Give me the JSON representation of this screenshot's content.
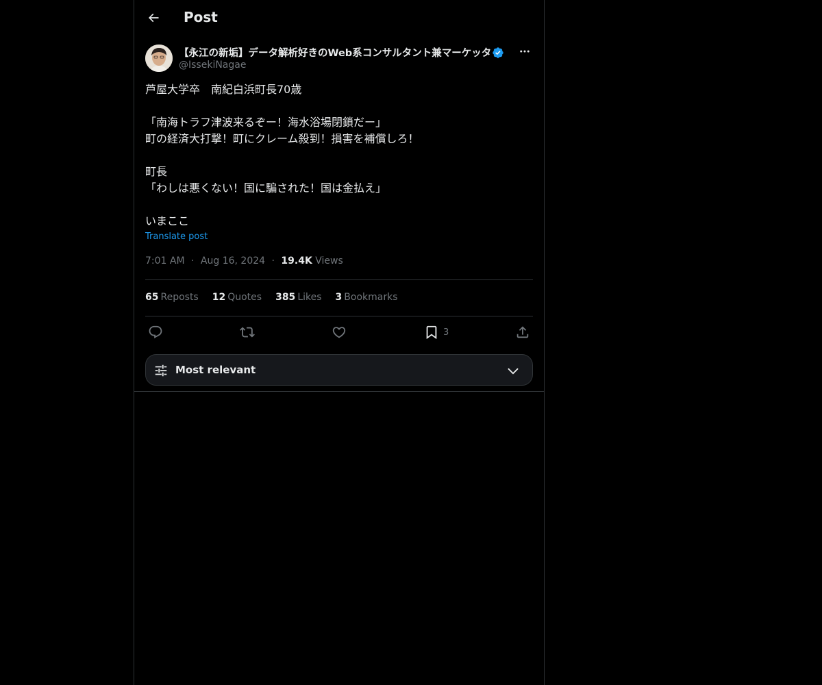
{
  "header": {
    "title": "Post",
    "back_icon": "arrow-left-icon"
  },
  "author": {
    "display_name": "【永江の新垢】データ解析好きのWeb系コンサルタント兼マーケッタ·",
    "handle": "@IssekiNagae",
    "verified_icon": "verified-badge-icon",
    "more_icon": "more-dots-icon"
  },
  "post": {
    "lines": [
      "芦屋大学卒　南紀白浜町長70歳",
      "",
      "「南海トラフ津波来るぞー！海水浴場閉鎖だー」",
      "町の経済大打撃！町にクレーム殺到！損害を補償しろ！",
      "",
      "町長",
      "「わしは悪くない！国に騙された！国は金払え」",
      "",
      "いまここ"
    ],
    "translate_label": "Translate post"
  },
  "meta": {
    "time": "7:01 AM",
    "separator": "·",
    "date": "Aug 16, 2024",
    "views_count": "19.4K",
    "views_label": "Views"
  },
  "stats": {
    "reposts": {
      "count": "65",
      "label": "Reposts"
    },
    "quotes": {
      "count": "12",
      "label": "Quotes"
    },
    "likes": {
      "count": "385",
      "label": "Likes"
    },
    "bookmarks": {
      "count": "3",
      "label": "Bookmarks"
    }
  },
  "actions": {
    "reply_icon": "reply-icon",
    "repost_icon": "repost-icon",
    "like_icon": "heart-icon",
    "bookmark_icon": "bookmark-icon",
    "bookmark_count": "3",
    "share_icon": "share-icon"
  },
  "sort": {
    "label": "Most relevant",
    "icon": "sliders-icon",
    "chevron": "chevron-down-icon"
  },
  "colors": {
    "background": "#000000",
    "text": "#e7e9ea",
    "muted": "#71767b",
    "accent": "#1d9bf0",
    "border": "#2f3336"
  }
}
